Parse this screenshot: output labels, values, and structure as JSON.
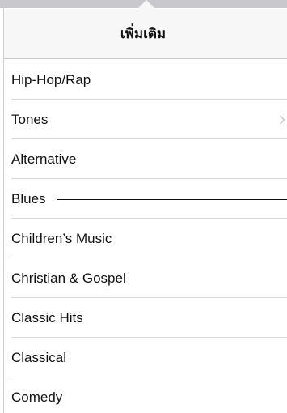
{
  "header": {
    "title": "เพิ่มเติม"
  },
  "genres": [
    {
      "label": "Hip-Hop/Rap"
    },
    {
      "label": "Tones"
    },
    {
      "label": "Alternative"
    },
    {
      "label": "Blues"
    },
    {
      "label": "Children’s Music"
    },
    {
      "label": "Christian & Gospel"
    },
    {
      "label": "Classic Hits"
    },
    {
      "label": "Classical"
    },
    {
      "label": "Comedy"
    }
  ],
  "icons": {
    "tones_disclosure": "chevron-right-icon",
    "popover_pointer": "popover-arrow"
  },
  "colors": {
    "header_background": "#f7f7f7",
    "separator": "#d9d9dc",
    "text": "#111111",
    "chevron": "#c7c7cc"
  }
}
